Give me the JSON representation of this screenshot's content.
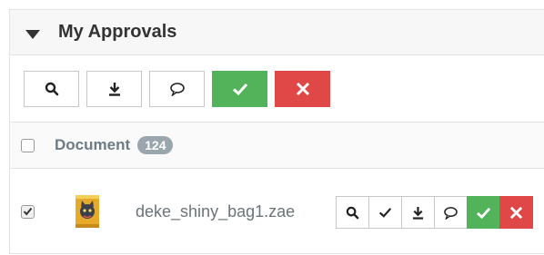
{
  "panel": {
    "title": "My Approvals"
  },
  "toolbar": {
    "buttons": [
      {
        "icon": "search-icon"
      },
      {
        "icon": "download-icon"
      },
      {
        "icon": "comment-icon"
      },
      {
        "icon": "approve-icon",
        "color": "#52b35b"
      },
      {
        "icon": "reject-icon",
        "color": "#e04848"
      }
    ]
  },
  "columns": {
    "document_label": "Document",
    "count": "124"
  },
  "rows": [
    {
      "checked": true,
      "filename": "deke_shiny_bag1.zae",
      "actions": [
        "search-icon",
        "check-icon",
        "download-icon",
        "comment-icon",
        "approve-icon",
        "reject-icon"
      ]
    }
  ]
}
